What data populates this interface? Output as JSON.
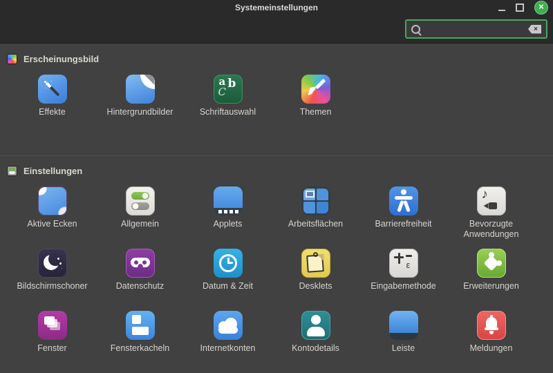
{
  "window": {
    "title": "Systemeinstellungen"
  },
  "toolbar": {
    "search_value": "",
    "search_placeholder": ""
  },
  "colors": {
    "accent_green": "#46a860",
    "close_button_green": "#3fae52",
    "titlebar_bg": "#2a2a2a",
    "content_bg": "#414141"
  },
  "sections": [
    {
      "label": "Erscheinungsbild",
      "icon": "rainbow-swatch-icon",
      "items": [
        {
          "label": "Effekte",
          "icon": "effekte"
        },
        {
          "label": "Hintergrundbilder",
          "icon": "hintergrundbilder"
        },
        {
          "label": "Schriftauswahl",
          "icon": "schriftauswahl"
        },
        {
          "label": "Themen",
          "icon": "themen"
        }
      ]
    },
    {
      "label": "Einstellungen",
      "icon": "mini-toggles-icon",
      "items": [
        {
          "label": "Aktive Ecken",
          "icon": "aktive-ecken"
        },
        {
          "label": "Allgemein",
          "icon": "allgemein"
        },
        {
          "label": "Applets",
          "icon": "applets"
        },
        {
          "label": "Arbeitsflächen",
          "icon": "arbeitsflaechen"
        },
        {
          "label": "Barrierefreiheit",
          "icon": "barrierefreiheit"
        },
        {
          "label": "Bevorzugte Anwendungen",
          "icon": "bevorzugte-anwendungen"
        },
        {
          "label": "Bildschirmschoner",
          "icon": "bildschirmschoner"
        },
        {
          "label": "Datenschutz",
          "icon": "datenschutz"
        },
        {
          "label": "Datum & Zeit",
          "icon": "datum-zeit"
        },
        {
          "label": "Desklets",
          "icon": "desklets"
        },
        {
          "label": "Eingabemethode",
          "icon": "eingabemethode"
        },
        {
          "label": "Erweiterungen",
          "icon": "erweiterungen"
        },
        {
          "label": "Fenster",
          "icon": "fenster"
        },
        {
          "label": "Fensterkacheln",
          "icon": "fensterkacheln"
        },
        {
          "label": "Internetkonten",
          "icon": "internetkonten"
        },
        {
          "label": "Kontodetails",
          "icon": "kontodetails"
        },
        {
          "label": "Leiste",
          "icon": "leiste"
        },
        {
          "label": "Meldungen",
          "icon": "meldungen"
        }
      ]
    }
  ]
}
